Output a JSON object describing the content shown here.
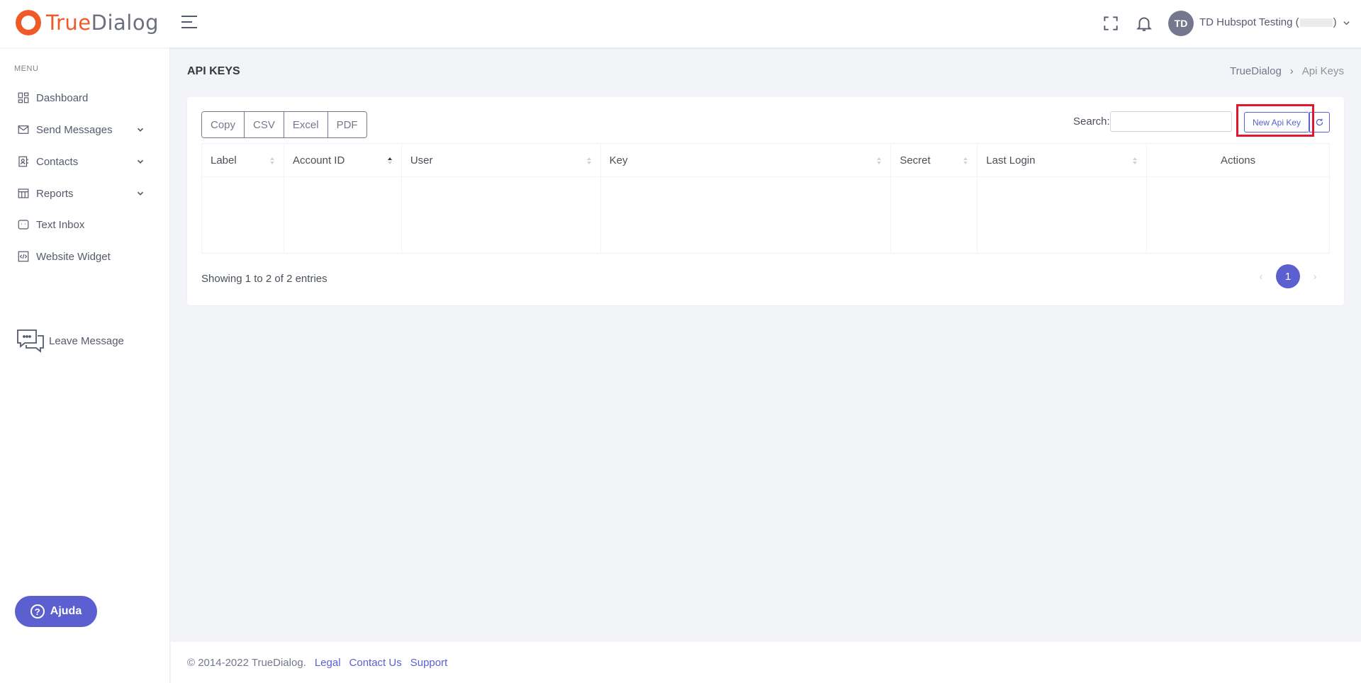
{
  "brand": {
    "part1": "True",
    "part2": "Dialog"
  },
  "header": {
    "avatar_initials": "TD",
    "user_name": "TD Hubspot Testing (",
    "user_name_close": ")"
  },
  "sidebar": {
    "menu_title": "MENU",
    "items": [
      {
        "label": "Dashboard",
        "icon": "dashboard-icon"
      },
      {
        "label": "Send Messages",
        "icon": "send-icon",
        "has_submenu": true
      },
      {
        "label": "Contacts",
        "icon": "contacts-icon",
        "has_submenu": true
      },
      {
        "label": "Reports",
        "icon": "reports-icon",
        "has_submenu": true
      },
      {
        "label": "Text Inbox",
        "icon": "inbox-icon"
      },
      {
        "label": "Website Widget",
        "icon": "code-icon"
      }
    ],
    "leave_message": "Leave Message",
    "help_button": "Ajuda"
  },
  "page": {
    "title": "API KEYS",
    "breadcrumb": [
      "TrueDialog",
      "Api Keys"
    ]
  },
  "toolbar": {
    "export_buttons": [
      "Copy",
      "CSV",
      "Excel",
      "PDF"
    ],
    "search_label": "Search:",
    "search_value": "",
    "new_key_label": "New Api Key"
  },
  "table": {
    "columns": [
      "Label",
      "Account ID",
      "User",
      "Key",
      "Secret",
      "Last Login",
      "Actions"
    ],
    "sorted_column": "Account ID",
    "sort_direction": "asc",
    "rows": []
  },
  "pagination": {
    "info": "Showing 1 to 2 of 2 entries",
    "current_page": "1",
    "prev": "‹",
    "next": "›"
  },
  "footer": {
    "copyright": "© 2014-2022 TrueDialog.",
    "links": [
      "Legal",
      "Contact Us",
      "Support"
    ]
  },
  "colors": {
    "brand_orange": "#f05a28",
    "accent": "#5b5fd0",
    "highlight": "#e0172e"
  }
}
